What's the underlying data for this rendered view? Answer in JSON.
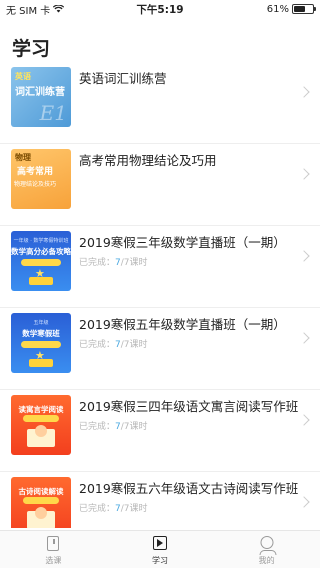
{
  "status": {
    "carrier": "无 SIM 卡",
    "time": "下午5:19",
    "battery": "61%",
    "battery_level": 0.61
  },
  "page": {
    "title": "学习"
  },
  "courses": [
    {
      "title": "英语词汇训练营",
      "thumb": {
        "tag": "英语",
        "name": "词汇训练营",
        "letters": "E1"
      }
    },
    {
      "title": "高考常用物理结论及巧用",
      "thumb": {
        "tag": "物理",
        "name": "高考常用",
        "sub": "物理结论及技巧"
      }
    },
    {
      "title": "2019寒假三年级数学直播班（一期）",
      "progress_label": "已完成：",
      "progress_done": "7",
      "progress_total": "/7课时",
      "thumb": {
        "top": "一年级 · 数学寒假特训班",
        "name": "数学高分必备攻略"
      }
    },
    {
      "title": "2019寒假五年级数学直播班（一期）",
      "progress_label": "已完成：",
      "progress_done": "7",
      "progress_total": "/7课时",
      "thumb": {
        "top": "五年级",
        "name": "数学寒假班"
      }
    },
    {
      "title": "2019寒假三四年级语文寓言阅读写作班",
      "progress_label": "已完成：",
      "progress_done": "7",
      "progress_total": "/7课时",
      "thumb": {
        "name": "读寓言学阅读"
      }
    },
    {
      "title": "2019寒假五六年级语文古诗阅读写作班",
      "progress_label": "已完成：",
      "progress_done": "7",
      "progress_total": "/7课时",
      "thumb": {
        "name": "古诗阅读解读"
      }
    }
  ],
  "tabs": [
    {
      "label": "选课",
      "icon": "course-select-icon"
    },
    {
      "label": "学习",
      "icon": "study-play-icon",
      "active": true
    },
    {
      "label": "我的",
      "icon": "profile-icon"
    }
  ],
  "colors": {
    "accent": "#4aa8e0",
    "muted": "#b8b8b8"
  }
}
